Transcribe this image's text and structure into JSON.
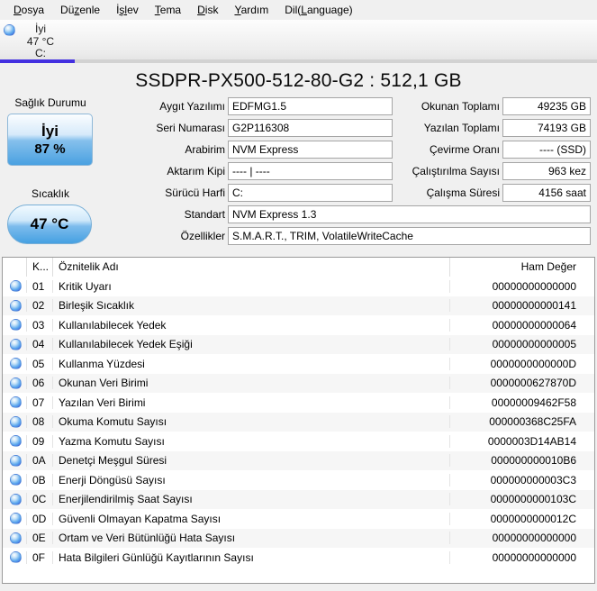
{
  "menu": {
    "items": [
      {
        "pre": "",
        "accel": "D",
        "post": "osya"
      },
      {
        "pre": "Dü",
        "accel": "z",
        "post": "enle"
      },
      {
        "pre": "İ",
        "accel": "şl",
        "post": "ev"
      },
      {
        "pre": "",
        "accel": "T",
        "post": "ema"
      },
      {
        "pre": "",
        "accel": "D",
        "post": "isk"
      },
      {
        "pre": "",
        "accel": "Y",
        "post": "ardım"
      },
      {
        "pre": "Dil(",
        "accel": "L",
        "post": "anguage)"
      }
    ]
  },
  "drive_tab": {
    "status": "İyi",
    "temperature": "47 °C",
    "letter": "C:"
  },
  "title": "SSDPR-PX500-512-80-G2 : 512,1 GB",
  "health": {
    "label": "Sağlık Durumu",
    "status": "İyi",
    "percent": "87 %"
  },
  "temperature": {
    "label": "Sıcaklık",
    "value": "47 °C"
  },
  "fields": {
    "left": [
      {
        "label": "Aygıt Yazılımı",
        "value": "EDFMG1.5"
      },
      {
        "label": "Seri Numarası",
        "value": "G2P116308"
      },
      {
        "label": "Arabirim",
        "value": "NVM Express"
      },
      {
        "label": "Aktarım Kipi",
        "value": "---- | ----"
      },
      {
        "label": "Sürücü Harfi",
        "value": "C:"
      }
    ],
    "wide": [
      {
        "label": "Standart",
        "value": "NVM Express 1.3"
      },
      {
        "label": "Özellikler",
        "value": "S.M.A.R.T., TRIM, VolatileWriteCache"
      }
    ],
    "right": [
      {
        "label": "Okunan Toplamı",
        "value": "49235 GB"
      },
      {
        "label": "Yazılan Toplamı",
        "value": "74193 GB"
      },
      {
        "label": "Çevirme Oranı",
        "value": "---- (SSD)"
      },
      {
        "label": "Çalıştırılma Sayısı",
        "value": "963 kez"
      },
      {
        "label": "Çalışma Süresi",
        "value": "4156 saat"
      }
    ]
  },
  "table": {
    "headers": {
      "id": "K...",
      "name": "Öznitelik Adı",
      "raw": "Ham Değer"
    },
    "rows": [
      {
        "id": "01",
        "name": "Kritik Uyarı",
        "raw": "00000000000000"
      },
      {
        "id": "02",
        "name": "Birleşik Sıcaklık",
        "raw": "00000000000141"
      },
      {
        "id": "03",
        "name": "Kullanılabilecek Yedek",
        "raw": "00000000000064"
      },
      {
        "id": "04",
        "name": "Kullanılabilecek Yedek Eşiği",
        "raw": "00000000000005"
      },
      {
        "id": "05",
        "name": "Kullanma Yüzdesi",
        "raw": "0000000000000D"
      },
      {
        "id": "06",
        "name": "Okunan Veri Birimi",
        "raw": "0000000627870D"
      },
      {
        "id": "07",
        "name": "Yazılan Veri Birimi",
        "raw": "00000009462F58"
      },
      {
        "id": "08",
        "name": "Okuma Komutu Sayısı",
        "raw": "000000368C25FA"
      },
      {
        "id": "09",
        "name": "Yazma Komutu Sayısı",
        "raw": "0000003D14AB14"
      },
      {
        "id": "0A",
        "name": "Denetçi Meşgul Süresi",
        "raw": "000000000010B6"
      },
      {
        "id": "0B",
        "name": "Enerji Döngüsü Sayısı",
        "raw": "000000000003C3"
      },
      {
        "id": "0C",
        "name": "Enerjilendirilmiş Saat Sayısı",
        "raw": "0000000000103C"
      },
      {
        "id": "0D",
        "name": "Güvenli Olmayan Kapatma Sayısı",
        "raw": "0000000000012C"
      },
      {
        "id": "0E",
        "name": "Ortam ve Veri Bütünlüğü Hata Sayısı",
        "raw": "00000000000000"
      },
      {
        "id": "0F",
        "name": "Hata Bilgileri Günlüğü Kayıtlarının Sayısı",
        "raw": "00000000000000"
      }
    ]
  },
  "colors": {
    "accent_underline": "#4330e0",
    "health_blue": "#4aa1e1",
    "status_orb_blue": "#3a57d8"
  }
}
